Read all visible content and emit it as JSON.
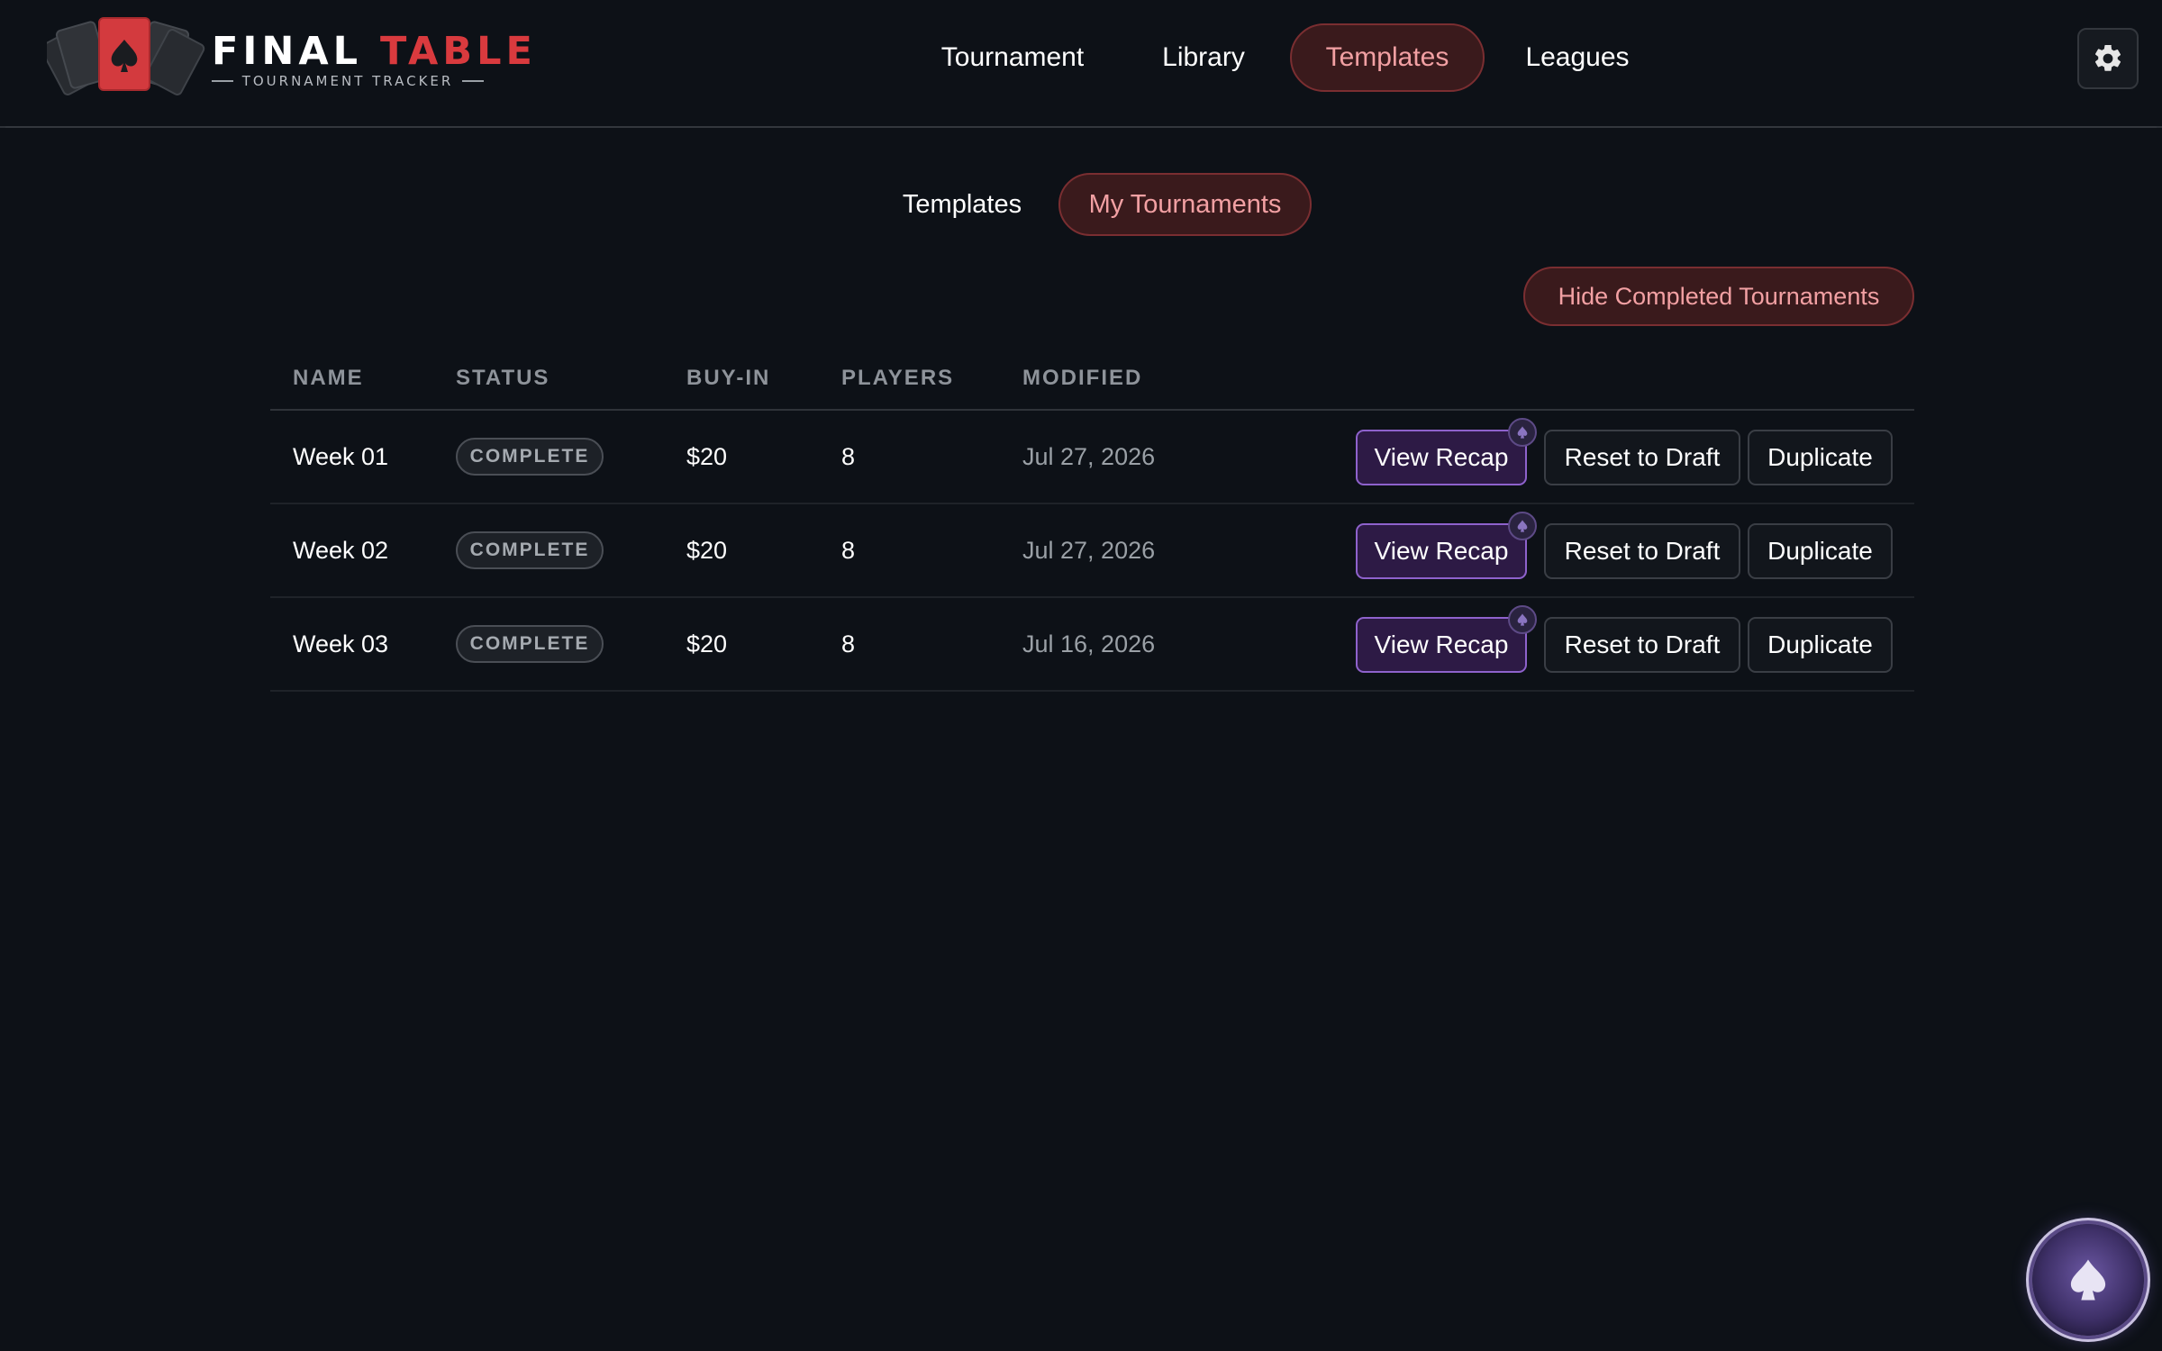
{
  "app": {
    "logo_word_1": "FINAL",
    "logo_word_2": "TABLE",
    "logo_subtitle": "TOURNAMENT TRACKER"
  },
  "nav": {
    "items": [
      {
        "label": "Tournament",
        "active": false
      },
      {
        "label": "Library",
        "active": false
      },
      {
        "label": "Templates",
        "active": true
      },
      {
        "label": "Leagues",
        "active": false
      }
    ],
    "settings_icon": "gear-icon"
  },
  "subtabs": {
    "items": [
      {
        "label": "Templates",
        "active": false
      },
      {
        "label": "My Tournaments",
        "active": true
      }
    ]
  },
  "toolbar": {
    "hide_completed_label": "Hide Completed Tournaments"
  },
  "table": {
    "columns": [
      "NAME",
      "STATUS",
      "BUY-IN",
      "PLAYERS",
      "MODIFIED"
    ],
    "rows": [
      {
        "name": "Week 01",
        "status": "COMPLETE",
        "buy_in": "$20",
        "players": "8",
        "modified": "Jul 27, 2026"
      },
      {
        "name": "Week 02",
        "status": "COMPLETE",
        "buy_in": "$20",
        "players": "8",
        "modified": "Jul 27, 2026"
      },
      {
        "name": "Week 03",
        "status": "COMPLETE",
        "buy_in": "$20",
        "players": "8",
        "modified": "Jul 16, 2026"
      }
    ],
    "actions": {
      "view_recap": "View Recap",
      "reset_to_draft": "Reset to Draft",
      "duplicate": "Duplicate"
    }
  },
  "colors": {
    "background": "#0d1117",
    "accent_red": "#d93a3e",
    "active_pill_bg": "#3a1a1c",
    "active_pill_text": "#f2a0a3",
    "recap_purple": "#8e62cc"
  },
  "fab": {
    "icon": "spade-icon"
  }
}
